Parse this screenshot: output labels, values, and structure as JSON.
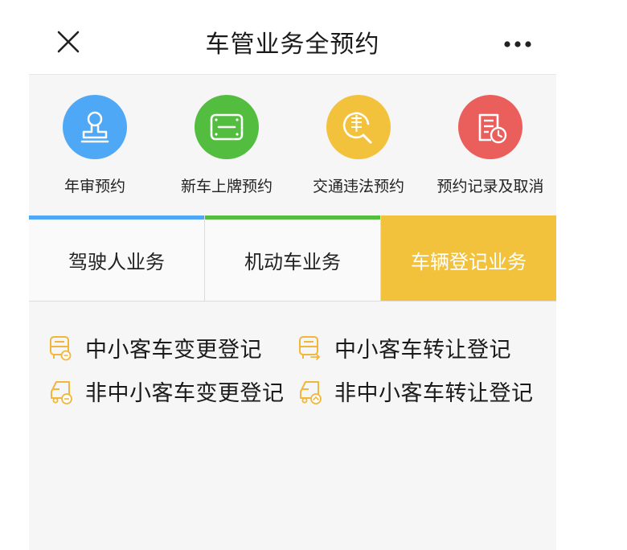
{
  "navbar": {
    "title": "车管业务全预约",
    "close_icon": "close-icon",
    "more_icon": "more-dots-icon"
  },
  "quick_actions": [
    {
      "label": "年审预约",
      "icon": "stamp-icon",
      "color": "#4ea8f5"
    },
    {
      "label": "新车上牌预约",
      "icon": "license-plate-icon",
      "color": "#52bd3e"
    },
    {
      "label": "交通违法预约",
      "icon": "violation-search-icon",
      "color": "#f3c23d"
    },
    {
      "label": "预约记录及取消",
      "icon": "record-clock-icon",
      "color": "#ea5f5b"
    }
  ],
  "tabs": [
    {
      "label": "驾驶人业务",
      "accent": "#4ea8f5",
      "active": false
    },
    {
      "label": "机动车业务",
      "accent": "#52bd3e",
      "active": false
    },
    {
      "label": "车辆登记业务",
      "accent": "#f3c23d",
      "active": true
    }
  ],
  "services": [
    {
      "label": "中小客车变更登记",
      "icon": "bus-edit-icon"
    },
    {
      "label": "中小客车转让登记",
      "icon": "bus-transfer-icon"
    },
    {
      "label": "非中小客车变更登记",
      "icon": "truck-edit-icon"
    },
    {
      "label": "非中小客车转让登记",
      "icon": "truck-transfer-icon"
    }
  ],
  "colors": {
    "accent_yellow": "#f3c23d",
    "icon_yellow": "#f0b73a"
  }
}
